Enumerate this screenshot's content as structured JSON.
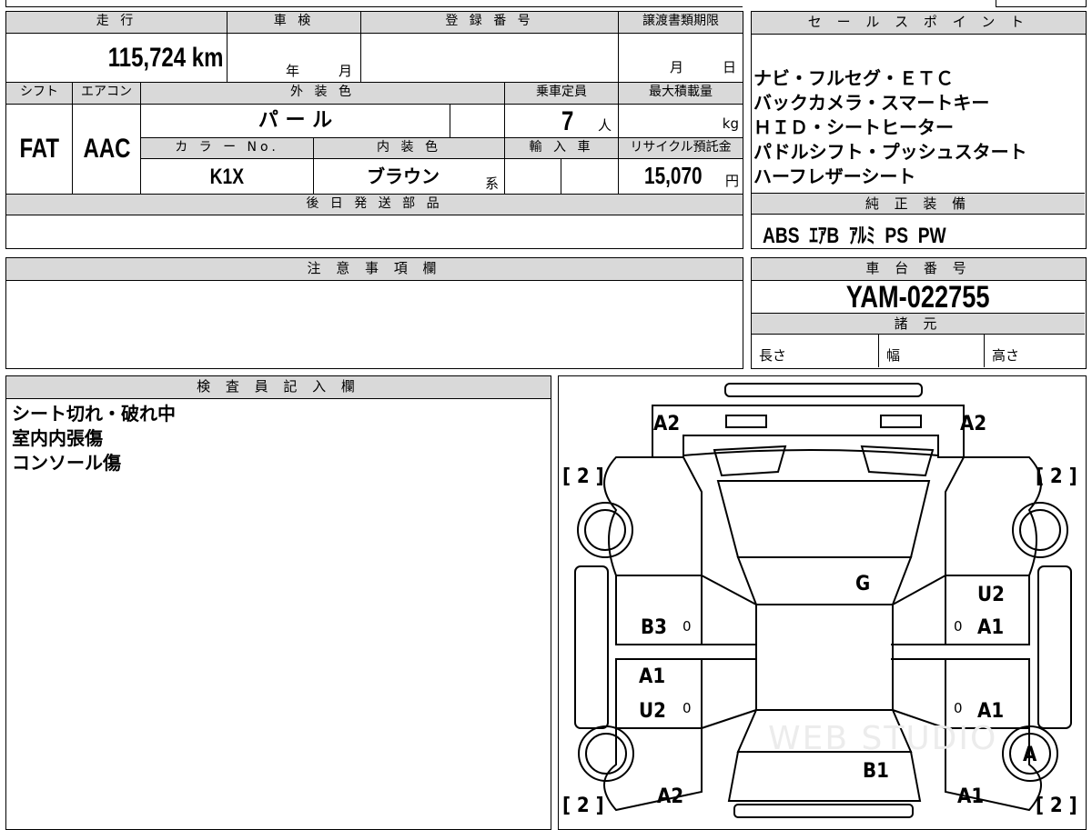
{
  "top_row": {
    "mileage_label": "走 行",
    "mileage_value": "115,724 km",
    "inspection_label": "車 検",
    "inspection_year": "年",
    "inspection_month": "月",
    "registration_label": "登 録 番 号",
    "transfer_label": "譲渡書類期限",
    "transfer_month": "月",
    "transfer_day": "日"
  },
  "row2": {
    "shift_label": "シフト",
    "shift_value": "FAT",
    "aircon_label": "エアコン",
    "aircon_value": "AAC",
    "exterior_label": "外 装 色",
    "exterior_value": "パ ー ル",
    "capacity_label": "乗車定員",
    "capacity_value": "7",
    "capacity_unit": "人",
    "load_label": "最大積載量",
    "load_unit": "kg",
    "color_no_label": "カ ラ ー No.",
    "color_no_value": "K1X",
    "interior_label": "内 装 色",
    "interior_value": "ブラウン",
    "interior_suffix": "系",
    "import_label": "輸 入 車",
    "recycle_label": "リサイクル預託金",
    "recycle_value": "15,070",
    "recycle_unit": "円"
  },
  "later_parts": {
    "label": "後 日 発 送 部 品",
    "value": ""
  },
  "sales_points": {
    "label": "セ ー ル ス ポ イ ン ト",
    "lines": [
      "ナビ・フルセグ・ＥＴＣ",
      "バックカメラ・スマートキー",
      "ＨＩＤ・シートヒーター",
      "パドルシフト・プッシュスタート",
      "ハーフレザーシート"
    ]
  },
  "equipment": {
    "label": "純 正 装 備",
    "value": "ABS  ｴｱB  ｱﾙﾐ  PS  PW"
  },
  "notes": {
    "label": "注 意 事 項 欄",
    "value": ""
  },
  "chassis": {
    "label": "車 台 番 号",
    "value": "YAM-022755"
  },
  "specs": {
    "label": "諸 元",
    "length": "長さ",
    "width": "幅",
    "height": "高さ"
  },
  "inspector": {
    "label": "検 査 員 記 入 欄",
    "lines": [
      "シート切れ・破れ中",
      "室内内張傷",
      "コンソール傷"
    ]
  },
  "diagram": {
    "marks": {
      "front_left": "A2",
      "front_right": "A2",
      "bracket_top_left": "[ 2 ]",
      "bracket_top_right": "[ 2 ]",
      "windshield": "G",
      "left_front_door": "B3",
      "left_rear_door_a": "A1",
      "left_rear_door_u": "U2",
      "right_front_door_u": "U2",
      "right_front_door_a": "A1",
      "right_rear_door": "A1",
      "right_rear_wheel": "A",
      "rear_center": "B1",
      "rear_left": "A2",
      "rear_right": "A1",
      "bracket_bottom_left": "[ 2 ]",
      "bracket_bottom_right": "[ 2 ]",
      "zero": "0",
      "watermark": "WEB STUDIO"
    }
  }
}
